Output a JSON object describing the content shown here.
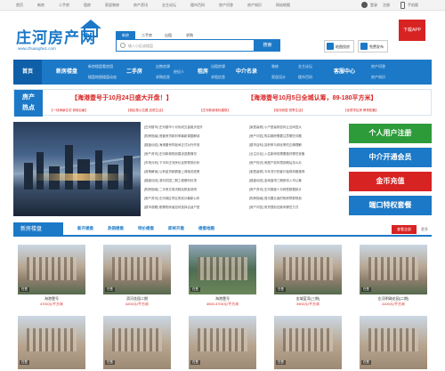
{
  "topbar": {
    "links": [
      "首页",
      "新房",
      "二手房",
      "租房",
      "家居装修",
      "房产资讯",
      "业主论坛",
      "楼市百科",
      "房产问答",
      "房产知识",
      "网站地图"
    ],
    "login": "登录",
    "register": "注册",
    "mobile": "手机版"
  },
  "logo": {
    "name": "庄河房产网",
    "url": "www.zhuanghe1.com"
  },
  "search": {
    "tabs": [
      "新房",
      "二手房",
      "出租",
      "求购"
    ],
    "placeholder": "输入小区或楼盘",
    "button": "搜索"
  },
  "header_buttons": {
    "map": "地图找房",
    "publish": "免费发布"
  },
  "app_badge": "下载APP",
  "nav": {
    "home": "首页",
    "mains": [
      "新房楼盘",
      "二手房",
      "租房",
      "中介名录",
      "客服中心"
    ],
    "subs": [
      [
        "新房楼盘",
        "楼盘地图",
        "看房团",
        "楼盘动态"
      ],
      [
        "出售房源",
        "求购信息",
        "经纪人"
      ],
      [
        "出租房源",
        "求租信息"
      ],
      [
        "装修",
        "家居设计",
        "业主论坛",
        "楼市百科"
      ],
      [
        "房产问答",
        "房产知识"
      ]
    ]
  },
  "hot": {
    "label": [
      "房产",
      "热点"
    ],
    "headlines": [
      "【海港壹号于10月24日盛大开盘！】",
      "【海港壹号10月5日全城认筹，89-180平方米】"
    ],
    "subs": [
      "【一线海景住宅 倾城巨献】",
      "【城区核心位置 品质生活】",
      "【庄河新城地标建筑】",
      "【临河而居 悦享生活】",
      "【优质学区房 教育配套】"
    ]
  },
  "news": {
    "left": [
      "[庄河楼市] 庄河楼市十月份成交量稳步回升",
      "[购房指南] 首套房贷款利率最新调整解读",
      "[楼盘动态] 海港壹号样板间正式对外开放",
      "[房产资讯] 庄河新城规划建设进展情况",
      "[市场分析] 下半年庄河房价走势预测分析",
      "[政策解读] 公积金贷款额度上调相关政策",
      "[楼盘动态] 滨河花园二期工程顺利封顶",
      "[购房指南] 二手房交易流程及税费说明",
      "[房产资讯] 庄河城区学区房划分最新公布",
      "[楼市观察] 刚需购房者如何选择合适户型"
    ],
    "right": [
      "[家居装修] 小户型装修如何让空间显大",
      "[房产问答] 购买期房需要注意哪些问题",
      "[楼市百科] 容积率与绿化率的正确理解",
      "[业主论坛] 入住新房前需要做好哪些准备",
      "[房产知识] 房屋产权年限到期后怎么办",
      "[家居装修] 今年流行的客厅装修风格推荐",
      "[楼盘动态] 金域蓝湾三期即将入市认筹",
      "[房产资讯] 庄河楼盘十月网签数据统计",
      "[购房指南] 首次置业者的购房预算规划",
      "[房产问答] 房贷提前还款有哪些方式"
    ]
  },
  "side_buttons": [
    {
      "label": "个人用户注册",
      "color": "#2e9b3a"
    },
    {
      "label": "中介开通会员",
      "color": "#1c79c7"
    },
    {
      "label": "金币充值",
      "color": "#d82323"
    },
    {
      "label": "端口特权套餐",
      "color": "#1c79c7"
    }
  ],
  "listing": {
    "title": "新房楼盘",
    "tabs": [
      "新开楼盘",
      "热销楼盘",
      "特价楼盘",
      "即将开盘",
      "楼盘地图"
    ],
    "more": "查看全部",
    "more2": "更多"
  },
  "cards_row1": [
    {
      "title": "海港壹号",
      "price": "4700元/平方米",
      "tag": "在售"
    },
    {
      "title": "滨河花园二期",
      "price": "4200元/平方米",
      "tag": "在售"
    },
    {
      "title": "海港壹号",
      "price": "4500-4700元/平方米",
      "tag": "在售"
    },
    {
      "title": "金域蓝湾(三期)",
      "price": "3900元/平方米",
      "tag": "在售"
    },
    {
      "title": "庄河明珠花园(二期)",
      "price": "4100元/平方米",
      "tag": "在售"
    }
  ],
  "cards_row2": [
    {
      "tag": "在售"
    },
    {
      "tag": "在售"
    },
    {
      "tag": "在售"
    },
    {
      "tag": "在售"
    },
    {
      "tag": "在售"
    }
  ]
}
